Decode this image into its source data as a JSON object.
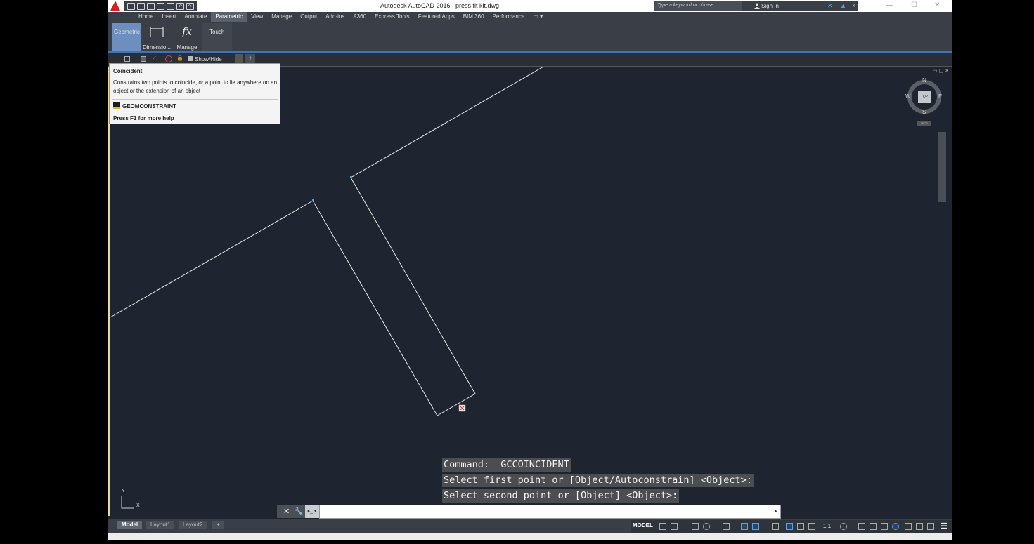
{
  "window": {
    "app_title": "Autodesk AutoCAD 2016",
    "file_name": "press fit kit.dwg",
    "search_placeholder": "Type a keyword or phrase",
    "sign_in_label": "Sign In"
  },
  "ribbon": {
    "tabs": [
      "Home",
      "Insert",
      "Annotate",
      "Parametric",
      "View",
      "Manage",
      "Output",
      "Add-ins",
      "A360",
      "Express Tools",
      "Featured Apps",
      "BIM 360",
      "Performance"
    ],
    "active_tab": "Parametric",
    "panel_buttons": {
      "geometric": "Geometric",
      "dimensional": "Dimensio...",
      "manage": "Manage",
      "manage_icon_text": "fx",
      "touch": "Touch"
    }
  },
  "subbar": {
    "show_hide": "Show/Hide",
    "add_tab": "+"
  },
  "tooltip": {
    "title": "Coincident",
    "description": "Constrains two points to coincide, or a point to lie anywhere on an object or the extension of an object",
    "command": "GEOMCONSTRAINT",
    "help": "Press F1 for more help"
  },
  "viewcube": {
    "north": "N",
    "south": "S",
    "east": "E",
    "west": "W",
    "face": "TOP",
    "wcs": "WCS"
  },
  "ucs": {
    "x": "X",
    "y": "Y"
  },
  "command_history": [
    "Command:  GCCOINCIDENT",
    "Select first point or [Object/Autoconstrain] <Object>:",
    "Select second point or [Object] <Object>:"
  ],
  "command_input": {
    "value": ""
  },
  "layout_tabs": [
    "Model",
    "Layout1",
    "Layout2"
  ],
  "layout_add": "+",
  "statusbar": {
    "model": "MODEL",
    "scale": "1:1"
  },
  "colors": {
    "canvas": "#1e2530",
    "ribbon": "#3a3f47",
    "accent": "#3d74b8",
    "drawing_line": "#e8e8e8",
    "grip": "#4aa3df"
  }
}
